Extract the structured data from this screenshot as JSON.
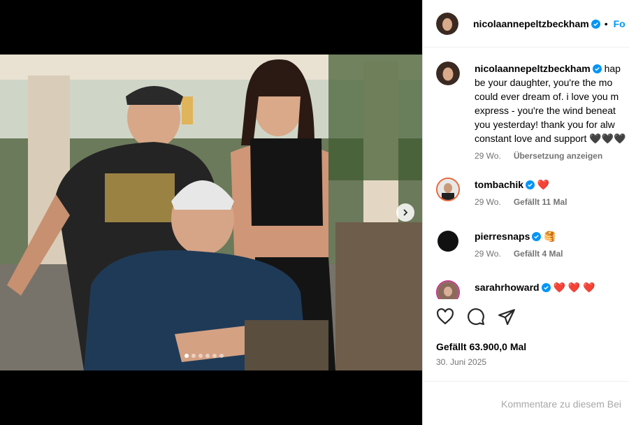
{
  "post": {
    "username": "nicolaannepeltzbeckham",
    "follow_label": "Fo",
    "separator": "•"
  },
  "caption": {
    "username": "nicolaannepeltzbeckham",
    "text": "hap\nbe your daughter, you're the mo\ncould ever dream of. i love you m\nexpress - you're the wind beneat\nyou yesterday! thank you for alw\nconstant love and support 🖤🖤🖤",
    "time": "29 Wo.",
    "translate_label": "Übersetzung anzeigen"
  },
  "comments": [
    {
      "username": "tombachik",
      "text": "❤️",
      "time": "29 Wo.",
      "likes": "Gefällt 11 Mal"
    },
    {
      "username": "pierresnaps",
      "text": "🥞",
      "time": "29 Wo.",
      "likes": "Gefällt 4 Mal"
    },
    {
      "username": "sarahrhoward",
      "text": "❤️ ❤️ ❤️",
      "time": "",
      "likes": ""
    }
  ],
  "likes_label": "Gefällt 63.900,0 Mal",
  "date_label": "30. Juni 2025",
  "add_comment_placeholder": "Kommentare zu diesem Bei",
  "carousel": {
    "slide_count": 6,
    "active_index": 0
  },
  "colors": {
    "accent": "#0095f6",
    "verified": "#0095f6",
    "heart": "#ed4956"
  }
}
